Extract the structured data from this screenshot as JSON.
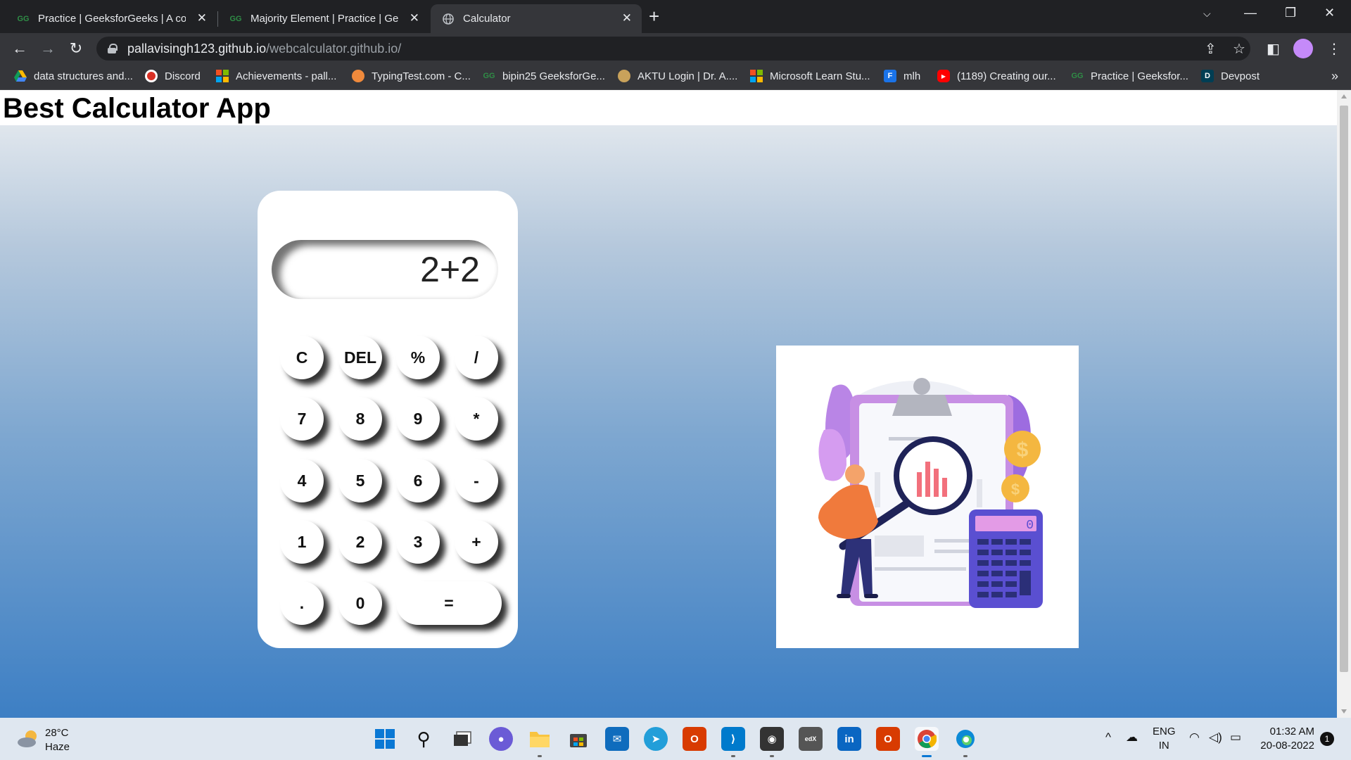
{
  "browser": {
    "tabs": [
      {
        "title": "Practice | GeeksforGeeks | A com",
        "favicon": "gfg-icon"
      },
      {
        "title": "Majority Element | Practice | Geek",
        "favicon": "gfg-icon"
      },
      {
        "title": "Calculator",
        "favicon": "globe-icon"
      }
    ],
    "url_host": "pallavisingh123.github.io",
    "url_path": "/webcalculator.github.io/",
    "bookmarks": [
      "data structures and...",
      "Discord",
      "Achievements - pall...",
      "TypingTest.com - C...",
      "bipin25 GeeksforGe...",
      "AKTU Login | Dr. A....",
      "Microsoft Learn Stu...",
      "mlh",
      "(1189) Creating our...",
      "Practice | Geeksfor...",
      "Devpost"
    ]
  },
  "page": {
    "title": "Best Calculator App",
    "calculator": {
      "display": "2+2",
      "keys": [
        "C",
        "DEL",
        "%",
        "/",
        "7",
        "8",
        "9",
        "*",
        "4",
        "5",
        "6",
        "-",
        "1",
        "2",
        "3",
        "+",
        ".",
        "0",
        "="
      ]
    },
    "illustration": {
      "calculator_screen": "0",
      "coin_symbol": "$"
    }
  },
  "taskbar": {
    "temperature": "28°C",
    "condition": "Haze",
    "language": "ENG",
    "region": "IN",
    "time": "01:32 AM",
    "date": "20-08-2022",
    "notification_count": "1"
  }
}
